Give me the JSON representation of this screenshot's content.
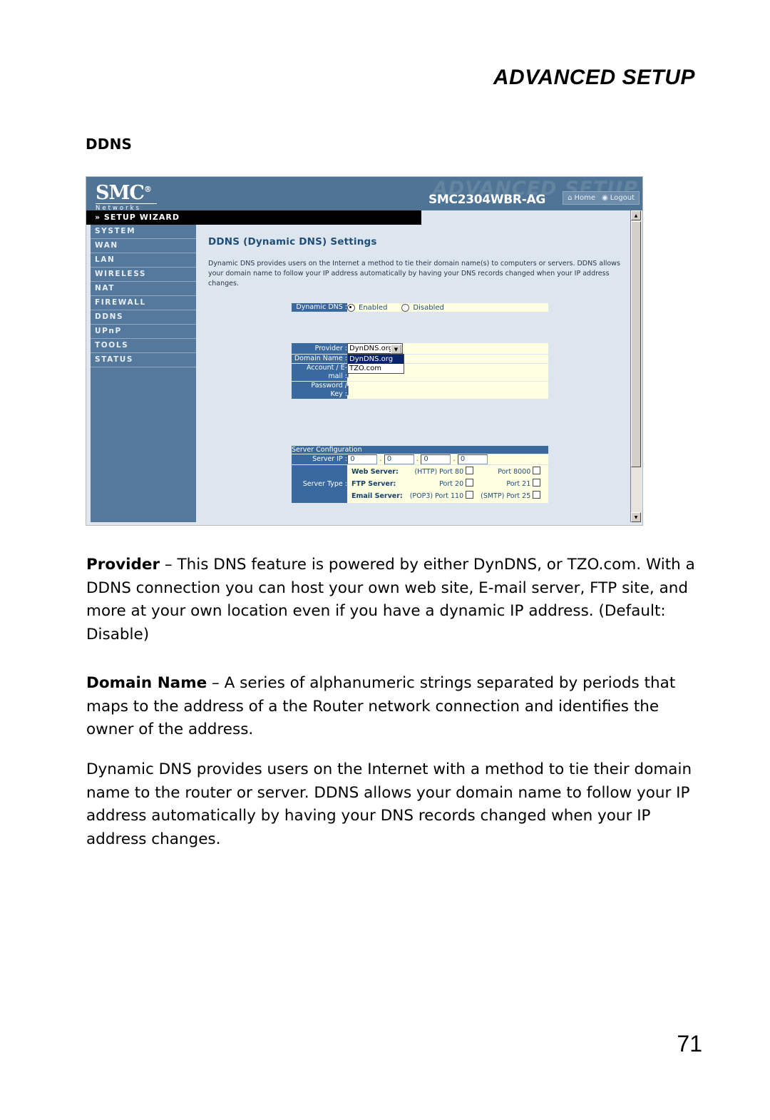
{
  "page": {
    "running_head": "ADVANCED SETUP",
    "section_title": "DDNS",
    "number": "71"
  },
  "screenshot": {
    "brand": {
      "logo_text": "SMC",
      "registered_mark": "®",
      "tagline": "Networks",
      "ghost_title": "ADVANCED SETUP",
      "model": "SMC2304WBR-AG",
      "home_label": "Home",
      "logout_label": "Logout"
    },
    "sidebar": {
      "wizard_label": "» SETUP WIZARD",
      "items": [
        {
          "label": "SYSTEM"
        },
        {
          "label": "WAN"
        },
        {
          "label": "LAN"
        },
        {
          "label": "WIRELESS"
        },
        {
          "label": "NAT"
        },
        {
          "label": "FIREWALL"
        },
        {
          "label": "DDNS"
        },
        {
          "label": "UPnP"
        },
        {
          "label": "TOOLS"
        },
        {
          "label": "STATUS"
        }
      ]
    },
    "content": {
      "title": "DDNS (Dynamic DNS) Settings",
      "description": "Dynamic DNS provides users on the Internet a method to tie their domain name(s) to computers or servers. DDNS allows your domain name to follow your IP address automatically by having your DNS records changed when your IP address changes.",
      "dynamic_dns": {
        "label": "Dynamic DNS :",
        "enabled_label": "Enabled",
        "disabled_label": "Disabled",
        "selected": "Enabled"
      },
      "provider": {
        "label": "Provider :",
        "value": "DynDNS.org",
        "options": [
          {
            "label": "DynDNS.org",
            "selected": true
          },
          {
            "label": "TZO.com",
            "selected": false
          }
        ],
        "dropdown_open": true
      },
      "domain_name": {
        "label": "Domain Name :",
        "value": ""
      },
      "account_email": {
        "label": "Account / E-mail :",
        "label_line1": "Account / E-",
        "label_line2": "mail :",
        "value": ""
      },
      "password_key": {
        "label": "Password / Key :",
        "label_line1": "Password /",
        "label_line2": "Key :",
        "value": ""
      },
      "server_configuration": {
        "heading": "Server Configuration",
        "server_ip": {
          "label": "Server IP :",
          "octets": [
            "0",
            "0",
            "0",
            "0"
          ],
          "separator": "."
        },
        "server_type": {
          "label": "Server Type :",
          "rows": [
            {
              "name": "Web Server:",
              "port_a": "(HTTP) Port 80",
              "checked_a": false,
              "port_b": "Port 8000",
              "checked_b": false
            },
            {
              "name": "FTP Server:",
              "port_a": "Port 20",
              "checked_a": false,
              "port_b": "Port 21",
              "checked_b": false
            },
            {
              "name": "Email Server:",
              "port_a": "(POP3) Port 110",
              "checked_a": false,
              "port_b": "(SMTP) Port 25",
              "checked_b": false
            }
          ]
        }
      }
    },
    "scrollbar": {
      "up_arrow": "▲",
      "down_arrow": "▼"
    },
    "colors": {
      "brand_blue": "#4f7496",
      "sidebar_blue": "#55799c",
      "label_blue": "#39699f",
      "field_yellow": "#ffffe1",
      "content_bg": "#dde5ee",
      "title_text": "#1f4e79"
    }
  },
  "body": {
    "para1_lead": "Provider",
    "para1_text": " – This DNS feature is powered by either DynDNS, or TZO.com. With a DDNS connection you can host your own web site, E-mail server, FTP site, and more at your own location even if you have a dynamic IP address. (Default: Disable)",
    "para2_lead": "Domain Name",
    "para2_text": " – A series of alphanumeric strings separated by periods that maps to the address of a the Router network connection and identifies the owner of the address.",
    "para3_text": "Dynamic DNS provides users on the Internet with a method to tie their domain name to the router or server. DDNS allows your domain name to follow your IP address automatically by having your DNS records changed when your IP address changes."
  }
}
